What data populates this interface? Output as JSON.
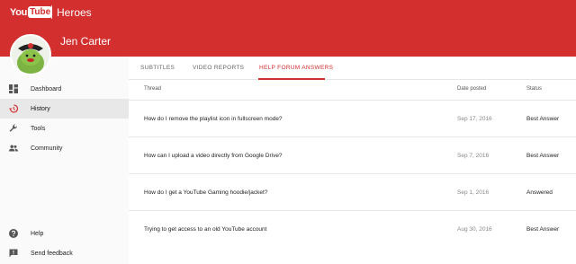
{
  "app": {
    "logo_you": "You",
    "logo_tube": "Tube",
    "name": "Heroes"
  },
  "user": {
    "name": "Jen Carter"
  },
  "sidebar": {
    "items": [
      {
        "label": "Dashboard",
        "icon": "dashboard-icon",
        "active": false
      },
      {
        "label": "History",
        "icon": "history-icon",
        "active": true
      },
      {
        "label": "Tools",
        "icon": "wrench-icon",
        "active": false
      },
      {
        "label": "Community",
        "icon": "people-icon",
        "active": false
      }
    ],
    "footer": [
      {
        "label": "Help",
        "icon": "help-icon"
      },
      {
        "label": "Send feedback",
        "icon": "feedback-icon"
      }
    ]
  },
  "tabs": [
    {
      "label": "SUBTITLES",
      "active": false
    },
    {
      "label": "VIDEO REPORTS",
      "active": false
    },
    {
      "label": "HELP FORUM ANSWERS",
      "active": true
    }
  ],
  "table": {
    "columns": [
      "Thread",
      "Date posted",
      "Status"
    ],
    "rows": [
      {
        "thread": "How do I remove the playlist icon in fullscreen mode?",
        "date": "Sep 17, 2016",
        "status": "Best Answer"
      },
      {
        "thread": "How can I upload a video directly from Google Drive?",
        "date": "Sep 7, 2016",
        "status": "Best Answer"
      },
      {
        "thread": "How do I get a YouTube Gaming hoodie/jacket?",
        "date": "Sep 1, 2016",
        "status": "Answered"
      },
      {
        "thread": "Trying to get access to an old YouTube account",
        "date": "Aug 30, 2016",
        "status": "Best Answer"
      }
    ]
  },
  "colors": {
    "brand_red": "#d32f2f"
  }
}
